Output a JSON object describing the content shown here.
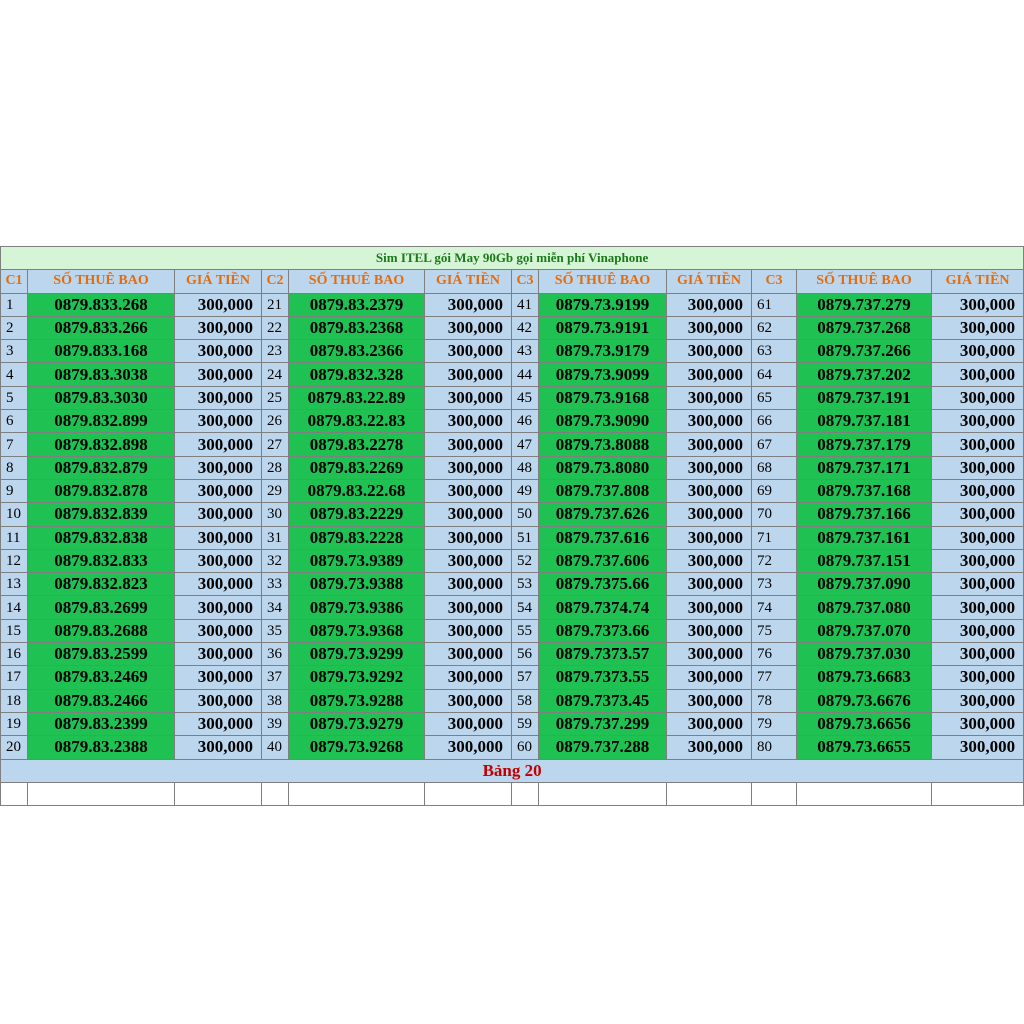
{
  "title": "Sim ITEL gói May 90Gb gọi miễn phí Vinaphone",
  "footer": "Bảng 20",
  "headers": [
    "C1",
    "SỐ THUÊ BAO",
    "GIÁ TIỀN",
    "C2",
    "SỐ THUÊ BAO",
    "GIÁ TIỀN",
    "C3",
    "SỐ THUÊ BAO",
    "GIÁ TIỀN",
    "C3",
    "SỐ THUÊ BAO",
    "GIÁ TIỀN"
  ],
  "rows": [
    [
      "1",
      "0879.833.268",
      "300,000",
      "21",
      "0879.83.2379",
      "300,000",
      "41",
      "0879.73.9199",
      "300,000",
      "61",
      "0879.737.279",
      "300,000"
    ],
    [
      "2",
      "0879.833.266",
      "300,000",
      "22",
      "0879.83.2368",
      "300,000",
      "42",
      "0879.73.9191",
      "300,000",
      "62",
      "0879.737.268",
      "300,000"
    ],
    [
      "3",
      "0879.833.168",
      "300,000",
      "23",
      "0879.83.2366",
      "300,000",
      "43",
      "0879.73.9179",
      "300,000",
      "63",
      "0879.737.266",
      "300,000"
    ],
    [
      "4",
      "0879.83.3038",
      "300,000",
      "24",
      "0879.832.328",
      "300,000",
      "44",
      "0879.73.9099",
      "300,000",
      "64",
      "0879.737.202",
      "300,000"
    ],
    [
      "5",
      "0879.83.3030",
      "300,000",
      "25",
      "0879.83.22.89",
      "300,000",
      "45",
      "0879.73.9168",
      "300,000",
      "65",
      "0879.737.191",
      "300,000"
    ],
    [
      "6",
      "0879.832.899",
      "300,000",
      "26",
      "0879.83.22.83",
      "300,000",
      "46",
      "0879.73.9090",
      "300,000",
      "66",
      "0879.737.181",
      "300,000"
    ],
    [
      "7",
      "0879.832.898",
      "300,000",
      "27",
      "0879.83.2278",
      "300,000",
      "47",
      "0879.73.8088",
      "300,000",
      "67",
      "0879.737.179",
      "300,000"
    ],
    [
      "8",
      "0879.832.879",
      "300,000",
      "28",
      "0879.83.2269",
      "300,000",
      "48",
      "0879.73.8080",
      "300,000",
      "68",
      "0879.737.171",
      "300,000"
    ],
    [
      "9",
      "0879.832.878",
      "300,000",
      "29",
      "0879.83.22.68",
      "300,000",
      "49",
      "0879.737.808",
      "300,000",
      "69",
      "0879.737.168",
      "300,000"
    ],
    [
      "10",
      "0879.832.839",
      "300,000",
      "30",
      "0879.83.2229",
      "300,000",
      "50",
      "0879.737.626",
      "300,000",
      "70",
      "0879.737.166",
      "300,000"
    ],
    [
      "11",
      "0879.832.838",
      "300,000",
      "31",
      "0879.83.2228",
      "300,000",
      "51",
      "0879.737.616",
      "300,000",
      "71",
      "0879.737.161",
      "300,000"
    ],
    [
      "12",
      "0879.832.833",
      "300,000",
      "32",
      "0879.73.9389",
      "300,000",
      "52",
      "0879.737.606",
      "300,000",
      "72",
      "0879.737.151",
      "300,000"
    ],
    [
      "13",
      "0879.832.823",
      "300,000",
      "33",
      "0879.73.9388",
      "300,000",
      "53",
      "0879.7375.66",
      "300,000",
      "73",
      "0879.737.090",
      "300,000"
    ],
    [
      "14",
      "0879.83.2699",
      "300,000",
      "34",
      "0879.73.9386",
      "300,000",
      "54",
      "0879.7374.74",
      "300,000",
      "74",
      "0879.737.080",
      "300,000"
    ],
    [
      "15",
      "0879.83.2688",
      "300,000",
      "35",
      "0879.73.9368",
      "300,000",
      "55",
      "0879.7373.66",
      "300,000",
      "75",
      "0879.737.070",
      "300,000"
    ],
    [
      "16",
      "0879.83.2599",
      "300,000",
      "36",
      "0879.73.9299",
      "300,000",
      "56",
      "0879.7373.57",
      "300,000",
      "76",
      "0879.737.030",
      "300,000"
    ],
    [
      "17",
      "0879.83.2469",
      "300,000",
      "37",
      "0879.73.9292",
      "300,000",
      "57",
      "0879.7373.55",
      "300,000",
      "77",
      "0879.73.6683",
      "300,000"
    ],
    [
      "18",
      "0879.83.2466",
      "300,000",
      "38",
      "0879.73.9288",
      "300,000",
      "58",
      "0879.7373.45",
      "300,000",
      "78",
      "0879.73.6676",
      "300,000"
    ],
    [
      "19",
      "0879.83.2399",
      "300,000",
      "39",
      "0879.73.9279",
      "300,000",
      "59",
      "0879.737.299",
      "300,000",
      "79",
      "0879.73.6656",
      "300,000"
    ],
    [
      "20",
      "0879.83.2388",
      "300,000",
      "40",
      "0879.73.9268",
      "300,000",
      "60",
      "0879.737.288",
      "300,000",
      "80",
      "0879.73.6655",
      "300,000"
    ]
  ],
  "colors": {
    "header_bg": "#bcd6ee",
    "header_text": "#e46c0a",
    "number_bg": "#1fc152",
    "title_bg": "#d6f5d6",
    "title_text": "#1a7a1a",
    "footer_text": "#c00000"
  }
}
